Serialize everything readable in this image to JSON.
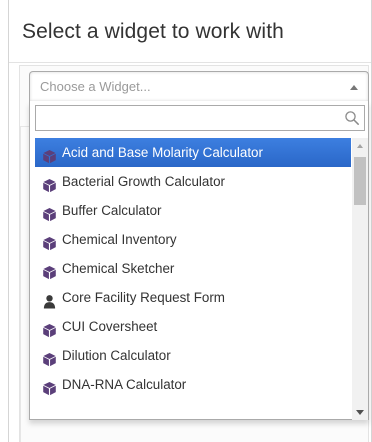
{
  "page": {
    "title": "Select a widget to work with"
  },
  "select": {
    "placeholder": "Choose a Widget...",
    "search_value": "",
    "search_placeholder": ""
  },
  "options": [
    {
      "label": "Acid and Base Molarity Calculator",
      "icon": "cube-icon",
      "highlighted": true
    },
    {
      "label": "Bacterial Growth Calculator",
      "icon": "cube-icon",
      "highlighted": false
    },
    {
      "label": "Buffer Calculator",
      "icon": "cube-icon",
      "highlighted": false
    },
    {
      "label": "Chemical Inventory",
      "icon": "cube-icon",
      "highlighted": false
    },
    {
      "label": "Chemical Sketcher",
      "icon": "cube-icon",
      "highlighted": false
    },
    {
      "label": "Core Facility Request Form",
      "icon": "person-icon",
      "highlighted": false
    },
    {
      "label": "CUI Coversheet",
      "icon": "cube-icon",
      "highlighted": false
    },
    {
      "label": "Dilution Calculator",
      "icon": "cube-icon",
      "highlighted": false
    },
    {
      "label": "DNA-RNA Calculator",
      "icon": "cube-icon",
      "highlighted": false
    }
  ],
  "colors": {
    "highlight": "#3875d7",
    "cube_icon": "#5b3f7a",
    "person_icon": "#3a3a3a",
    "text": "#333333",
    "placeholder": "#9a9a9a"
  }
}
